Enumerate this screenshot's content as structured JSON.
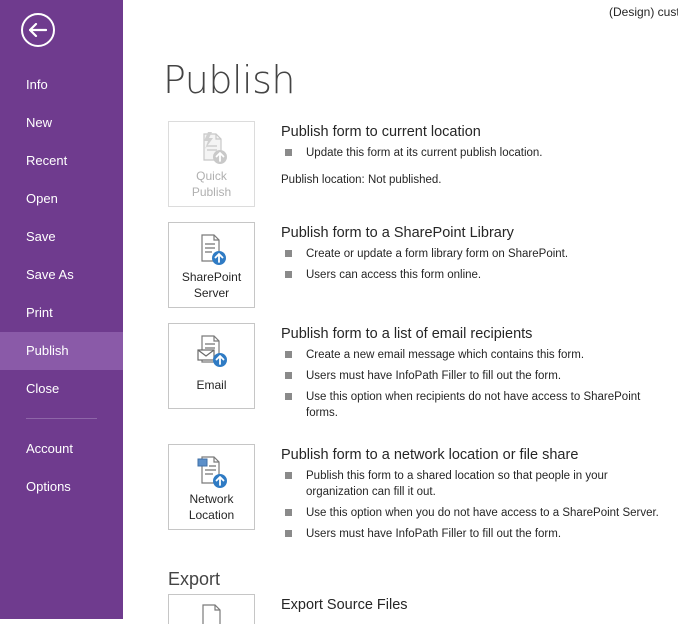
{
  "header": {
    "user_label": "(Design) cust"
  },
  "sidebar": {
    "items": [
      {
        "label": "Info"
      },
      {
        "label": "New"
      },
      {
        "label": "Recent"
      },
      {
        "label": "Open"
      },
      {
        "label": "Save"
      },
      {
        "label": "Save As"
      },
      {
        "label": "Print"
      },
      {
        "label": "Publish",
        "active": true
      },
      {
        "label": "Close"
      },
      {
        "label": "Account"
      },
      {
        "label": "Options"
      }
    ]
  },
  "main": {
    "title": "Publish",
    "sections": [
      {
        "tile_label": "Quick Publish",
        "icon": "quick-publish-icon",
        "disabled": true,
        "title": "Publish form to current location",
        "bullets": [
          "Update this form at its current publish location."
        ],
        "note": "Publish location: Not published."
      },
      {
        "tile_label": "SharePoint Server",
        "icon": "sharepoint-icon",
        "title": "Publish form to a SharePoint Library",
        "bullets": [
          "Create or update a form library form on SharePoint.",
          "Users can access this form online."
        ]
      },
      {
        "tile_label": "Email",
        "icon": "email-icon",
        "title": "Publish form to a list of email recipients",
        "bullets": [
          "Create a new email message which contains this form.",
          "Users must have InfoPath Filler to fill out the form.",
          "Use this option when recipients do not have access to SharePoint forms."
        ]
      },
      {
        "tile_label": "Network Location",
        "icon": "network-location-icon",
        "title": "Publish form to a network location or file share",
        "bullets": [
          "Publish this form to a shared location so that people in your organization can fill it out.",
          "Use this option when you do not have access to a SharePoint Server.",
          "Users must have InfoPath Filler to fill out the form."
        ]
      }
    ],
    "export": {
      "title": "Export",
      "section_title": "Export Source Files"
    }
  },
  "colors": {
    "sidebar_bg": "#6f3b8e",
    "sidebar_active": "#8a5aa8",
    "accent_blue": "#2f7bc4"
  }
}
